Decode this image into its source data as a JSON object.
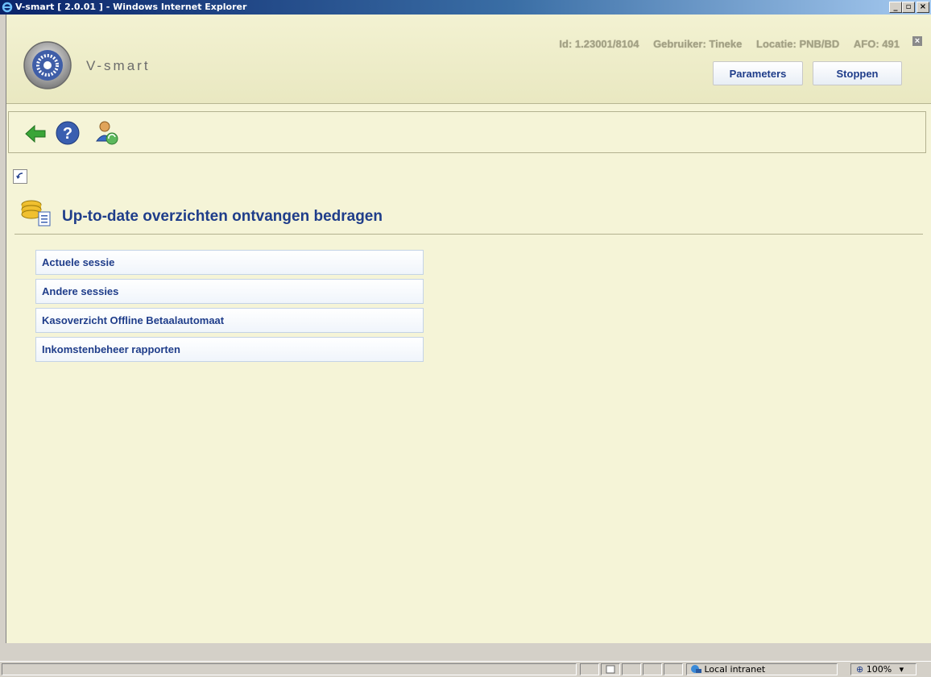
{
  "window": {
    "title": "V-smart [ 2.0.01 ] - Windows Internet Explorer",
    "minimize": "_",
    "maximize": "▫",
    "close": "×"
  },
  "header": {
    "brand": "V-smart",
    "info": {
      "id": "Id: 1.23001/8104",
      "user": "Gebruiker: Tineke",
      "location": "Locatie: PNB/BD",
      "afo": "AFO: 491"
    },
    "buttons": {
      "parameters": "Parameters",
      "stop": "Stoppen"
    }
  },
  "toolbar": {
    "icons": [
      "back-arrow-icon",
      "help-icon",
      "user-switch-icon"
    ]
  },
  "page": {
    "title": "Up-to-date overzichten ontvangen bedragen"
  },
  "menu": [
    {
      "label": "Actuele sessie"
    },
    {
      "label": "Andere sessies"
    },
    {
      "label": "Kasoverzicht Offline Betaalautomaat"
    },
    {
      "label": "Inkomstenbeheer rapporten"
    }
  ],
  "statusbar": {
    "zone": "Local intranet",
    "zoom": "100%"
  },
  "colors": {
    "background": "#f5f4d7",
    "accent": "#1f3d8a",
    "titlebar": "#0a246a"
  }
}
